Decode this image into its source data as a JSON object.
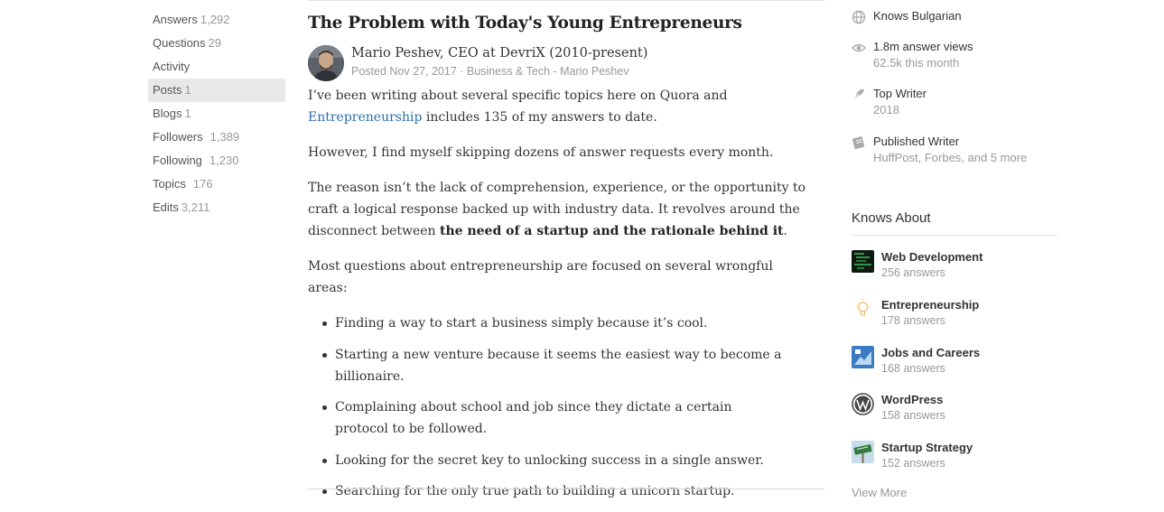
{
  "nav": {
    "items": [
      {
        "label": "Answers",
        "count": "1,292"
      },
      {
        "label": "Questions",
        "count": "29"
      },
      {
        "label": "Activity",
        "count": ""
      },
      {
        "label": "Posts",
        "count": "1"
      },
      {
        "label": "Blogs",
        "count": "1"
      },
      {
        "label": "Followers",
        "count": "1,389"
      },
      {
        "label": "Following",
        "count": "1,230"
      },
      {
        "label": "Topics",
        "count": "176"
      },
      {
        "label": "Edits",
        "count": "3,211"
      }
    ],
    "active": "Posts"
  },
  "post": {
    "title": "The Problem with Today's Young Entrepreneurs",
    "author_name": "Mario Peshev, CEO at DevriX (2010-present)",
    "posted": "Posted Nov 27, 2017",
    "separator": " · ",
    "blog": "Business & Tech - Mario Peshev",
    "p1_before": "I’ve been writing about several specific topics here on Quora and ",
    "p1_link": "Entrepreneurship",
    "p1_after": " includes 135 of my answers to date.",
    "p2": "However, I find myself skipping dozens of answer requests every month.",
    "p3_before": "The reason isn’t the lack of comprehension, experience, or the opportunity to craft a logical response backed up with industry data. It revolves around the disconnect between ",
    "p3_bold": "the need of a startup and the rationale behind it",
    "p3_after": ".",
    "p4": "Most questions about entrepreneurship are focused on several wrongful areas:",
    "bullets": [
      "Finding a way to start a business simply because it’s cool.",
      "Starting a new venture because it seems the easiest way to become a billionaire.",
      "Complaining about school and job since they dictate a certain protocol to be followed.",
      "Looking for the secret key to unlocking success in a single answer.",
      "Searching for the only true path to building a unicorn startup."
    ]
  },
  "credentials": [
    {
      "icon": "globe-icon",
      "line1": "Knows Bulgarian",
      "line2": ""
    },
    {
      "icon": "eye-icon",
      "line1": "1.8m answer views",
      "line2": "62.5k this month"
    },
    {
      "icon": "feather-icon",
      "line1": "Top Writer",
      "line2": "2018"
    },
    {
      "icon": "newspaper-icon",
      "line1": "Published Writer",
      "line2": "HuffPost, Forbes, and 5 more"
    }
  ],
  "knows_about": {
    "heading": "Knows About",
    "topics": [
      {
        "name": "Web Development",
        "count": "256 answers",
        "thumb": "code-thumb"
      },
      {
        "name": "Entrepreneurship",
        "count": "178 answers",
        "thumb": "lightbulb-thumb"
      },
      {
        "name": "Jobs and Careers",
        "count": "168 answers",
        "thumb": "career-thumb"
      },
      {
        "name": "WordPress",
        "count": "158 answers",
        "thumb": "wordpress-logo"
      },
      {
        "name": "Startup Strategy",
        "count": "152 answers",
        "thumb": "sign-thumb"
      }
    ],
    "view_more": "View More"
  },
  "colors": {
    "link": "#2b6dad",
    "muted": "#999999",
    "active_nav_bg": "#e8e8e8",
    "text": "#333333"
  }
}
